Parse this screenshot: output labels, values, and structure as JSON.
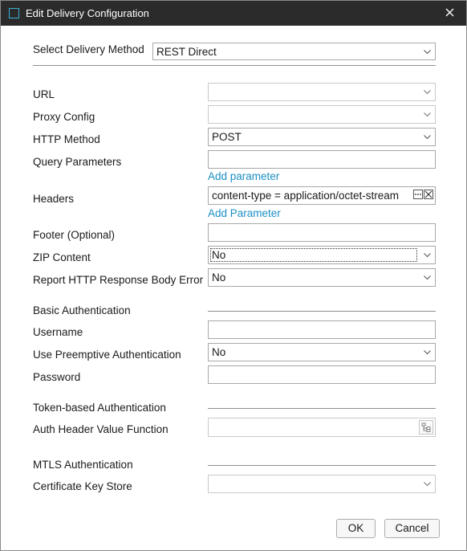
{
  "window": {
    "title": "Edit Delivery Configuration"
  },
  "delivery": {
    "label": "Select Delivery Method",
    "value": "REST Direct"
  },
  "url": {
    "label": "URL",
    "value": ""
  },
  "proxy": {
    "label": "Proxy Config",
    "value": ""
  },
  "http_method": {
    "label": "HTTP Method",
    "value": "POST"
  },
  "query_params": {
    "label": "Query Parameters",
    "value": "",
    "add_link": "Add parameter"
  },
  "headers": {
    "label": "Headers",
    "value": "content-type = application/octet-stream",
    "add_link": "Add Parameter"
  },
  "footer": {
    "label": "Footer (Optional)",
    "value": ""
  },
  "zip": {
    "label": "ZIP Content",
    "value": "No"
  },
  "report_error": {
    "label": "Report HTTP Response Body Error",
    "value": "No"
  },
  "basic_auth": {
    "section": "Basic Authentication",
    "username_label": "Username",
    "username_value": "",
    "preemptive_label": "Use Preemptive Authentication",
    "preemptive_value": "No",
    "password_label": "Password",
    "password_value": ""
  },
  "token_auth": {
    "section": "Token-based Authentication",
    "function_label": "Auth Header Value Function",
    "function_value": ""
  },
  "mtls": {
    "section": "MTLS Authentication",
    "keystore_label": "Certificate Key Store",
    "keystore_value": ""
  },
  "buttons": {
    "ok": "OK",
    "cancel": "Cancel"
  },
  "icons": {
    "close": "close-icon",
    "dropdown": "chevron-down-icon",
    "tree": "tree-picker-icon"
  }
}
